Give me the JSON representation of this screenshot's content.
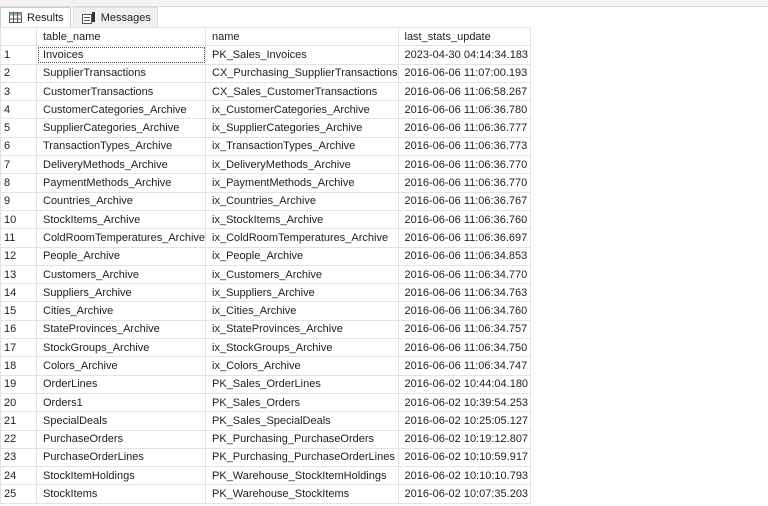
{
  "tabs": [
    {
      "label": "Results",
      "icon": "grid-icon"
    },
    {
      "label": "Messages",
      "icon": "messages-icon"
    }
  ],
  "columns": [
    "",
    "table_name",
    "name",
    "last_stats_update"
  ],
  "rows": [
    [
      "1",
      "Invoices",
      "PK_Sales_Invoices",
      "2023-04-30 04:14:34.183"
    ],
    [
      "2",
      "SupplierTransactions",
      "CX_Purchasing_SupplierTransactions",
      "2016-06-06 11:07:00.193"
    ],
    [
      "3",
      "CustomerTransactions",
      "CX_Sales_CustomerTransactions",
      "2016-06-06 11:06:58.267"
    ],
    [
      "4",
      "CustomerCategories_Archive",
      "ix_CustomerCategories_Archive",
      "2016-06-06 11:06:36.780"
    ],
    [
      "5",
      "SupplierCategories_Archive",
      "ix_SupplierCategories_Archive",
      "2016-06-06 11:06:36.777"
    ],
    [
      "6",
      "TransactionTypes_Archive",
      "ix_TransactionTypes_Archive",
      "2016-06-06 11:06:36.773"
    ],
    [
      "7",
      "DeliveryMethods_Archive",
      "ix_DeliveryMethods_Archive",
      "2016-06-06 11:06:36.770"
    ],
    [
      "8",
      "PaymentMethods_Archive",
      "ix_PaymentMethods_Archive",
      "2016-06-06 11:06:36.770"
    ],
    [
      "9",
      "Countries_Archive",
      "ix_Countries_Archive",
      "2016-06-06 11:06:36.767"
    ],
    [
      "10",
      "StockItems_Archive",
      "ix_StockItems_Archive",
      "2016-06-06 11:06:36.760"
    ],
    [
      "11",
      "ColdRoomTemperatures_Archive",
      "ix_ColdRoomTemperatures_Archive",
      "2016-06-06 11:06:36.697"
    ],
    [
      "12",
      "People_Archive",
      "ix_People_Archive",
      "2016-06-06 11:06:34.853"
    ],
    [
      "13",
      "Customers_Archive",
      "ix_Customers_Archive",
      "2016-06-06 11:06:34.770"
    ],
    [
      "14",
      "Suppliers_Archive",
      "ix_Suppliers_Archive",
      "2016-06-06 11:06:34.763"
    ],
    [
      "15",
      "Cities_Archive",
      "ix_Cities_Archive",
      "2016-06-06 11:06:34.760"
    ],
    [
      "16",
      "StateProvinces_Archive",
      "ix_StateProvinces_Archive",
      "2016-06-06 11:06:34.757"
    ],
    [
      "17",
      "StockGroups_Archive",
      "ix_StockGroups_Archive",
      "2016-06-06 11:06:34.750"
    ],
    [
      "18",
      "Colors_Archive",
      "ix_Colors_Archive",
      "2016-06-06 11:06:34.747"
    ],
    [
      "19",
      "OrderLines",
      "PK_Sales_OrderLines",
      "2016-06-02 10:44:04.180"
    ],
    [
      "20",
      "Orders1",
      "PK_Sales_Orders",
      "2016-06-02 10:39:54.253"
    ],
    [
      "21",
      "SpecialDeals",
      "PK_Sales_SpecialDeals",
      "2016-06-02 10:25:05.127"
    ],
    [
      "22",
      "PurchaseOrders",
      "PK_Purchasing_PurchaseOrders",
      "2016-06-02 10:19:12.807"
    ],
    [
      "23",
      "PurchaseOrderLines",
      "PK_Purchasing_PurchaseOrderLines",
      "2016-06-02 10:10:59.917"
    ],
    [
      "24",
      "StockItemHoldings",
      "PK_Warehouse_StockItemHoldings",
      "2016-06-02 10:10:10.793"
    ],
    [
      "25",
      "StockItems",
      "PK_Warehouse_StockItems",
      "2016-06-02 10:07:35.203"
    ]
  ]
}
